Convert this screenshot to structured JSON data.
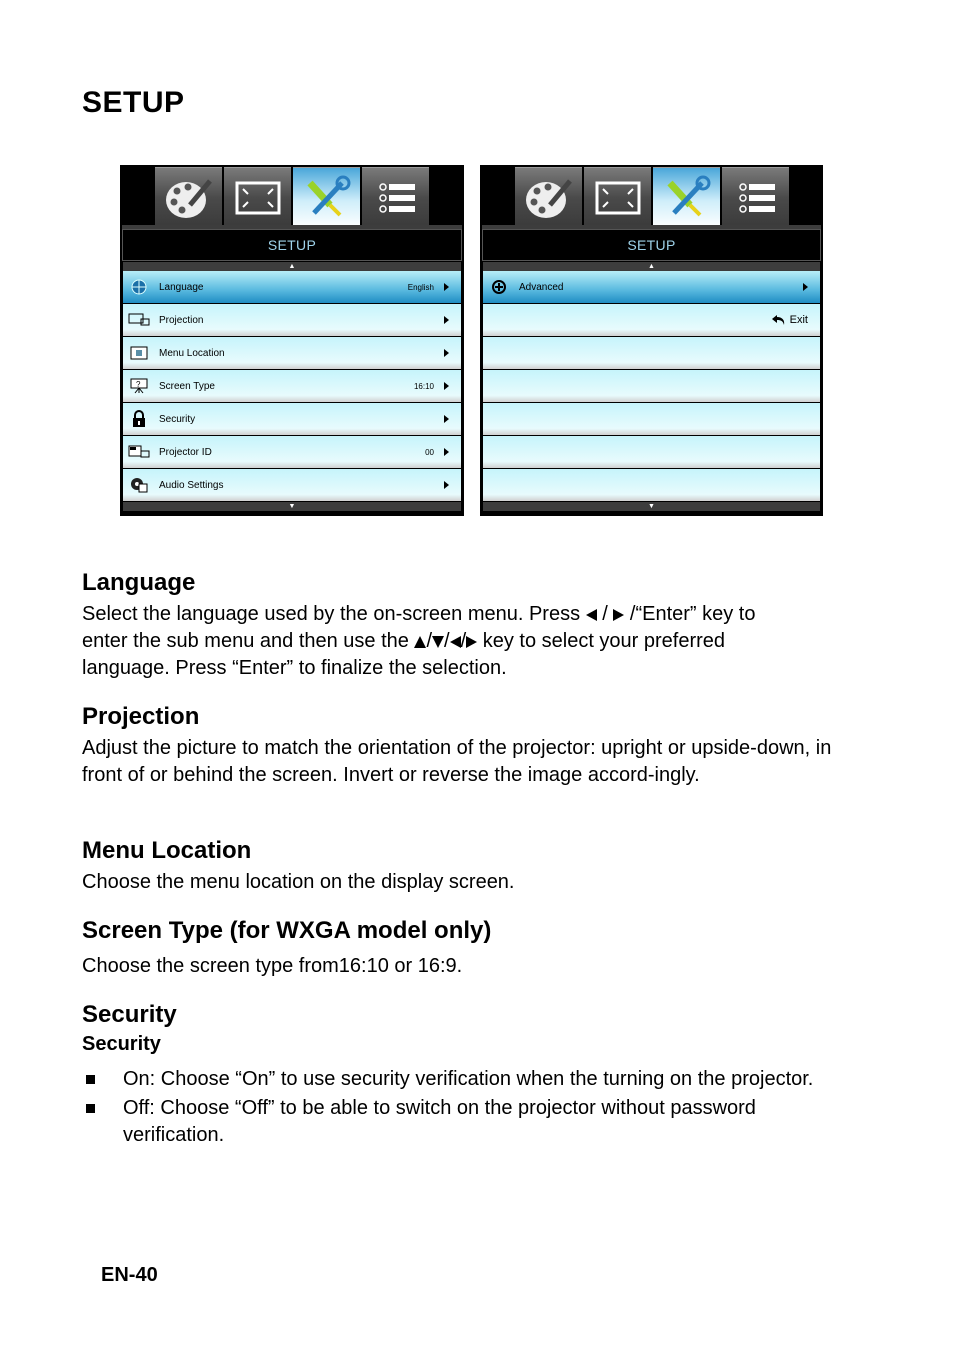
{
  "page": {
    "title": "SETUP",
    "footer": "EN-40"
  },
  "osd_left": {
    "tabs": [
      {
        "icon": "palette-icon",
        "label": "Image"
      },
      {
        "icon": "display-icon",
        "label": "Display"
      },
      {
        "icon": "tools-icon",
        "label": "Setup",
        "active": true
      },
      {
        "icon": "options-icon",
        "label": "Options"
      }
    ],
    "title": "SETUP",
    "items": [
      {
        "label": "Language",
        "value": "English",
        "icon": "globe-icon",
        "selected": true
      },
      {
        "label": "Projection",
        "value": "",
        "icon": "projection-icon"
      },
      {
        "label": "Menu Location",
        "value": "",
        "icon": "menu-location-icon"
      },
      {
        "label": "Screen Type",
        "value": "16:10",
        "icon": "screen-type-icon"
      },
      {
        "label": "Security",
        "value": "",
        "icon": "lock-icon"
      },
      {
        "label": "Projector ID",
        "value": "00",
        "icon": "projector-id-icon"
      },
      {
        "label": "Audio Settings",
        "value": "",
        "icon": "audio-settings-icon"
      }
    ]
  },
  "osd_right": {
    "title": "SETUP",
    "items": [
      {
        "label": "Advanced",
        "icon": "advanced-icon",
        "selected": true
      }
    ],
    "exit_label": "Exit"
  },
  "sections": {
    "language": {
      "heading": "Language",
      "text1": "Select the language used by the on-screen menu. Press ",
      "text2": " /“Enter” key to",
      "text3": "enter the sub menu and then use the ",
      "text4": " key to select your preferred",
      "text5": "language. Press “Enter” to finalize the selection."
    },
    "projection": {
      "heading": "Projection",
      "text": "Adjust the picture to match the orientation of the projector: upright or upside-down, in front of or behind the screen. Invert or reverse the image accord-ingly."
    },
    "menu_location": {
      "heading": "Menu Location",
      "text": "Choose the menu location on the display screen."
    },
    "screen_type": {
      "heading": "Screen Type (for WXGA model only)",
      "text": "Choose the screen type from16:10 or 16:9."
    },
    "security": {
      "heading": "Security",
      "subheading": "Security",
      "bullets": [
        "On: Choose “On” to use security verification when the turning on the projector.",
        "Off: Choose “Off” to be able to switch on the projector without password verification."
      ]
    }
  }
}
